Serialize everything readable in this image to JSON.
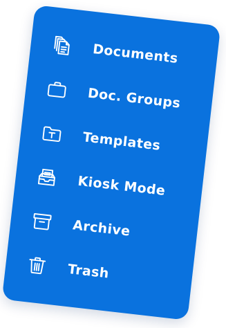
{
  "menu": {
    "items": [
      {
        "label": "Documents",
        "icon": "documents-icon"
      },
      {
        "label": "Doc. Groups",
        "icon": "briefcase-icon"
      },
      {
        "label": "Templates",
        "icon": "template-folder-icon"
      },
      {
        "label": "Kiosk Mode",
        "icon": "kiosk-tray-icon"
      },
      {
        "label": "Archive",
        "icon": "archive-box-icon"
      },
      {
        "label": "Trash",
        "icon": "trash-icon"
      }
    ]
  },
  "colors": {
    "card_background": "#0a72de",
    "foreground": "#ffffff"
  }
}
